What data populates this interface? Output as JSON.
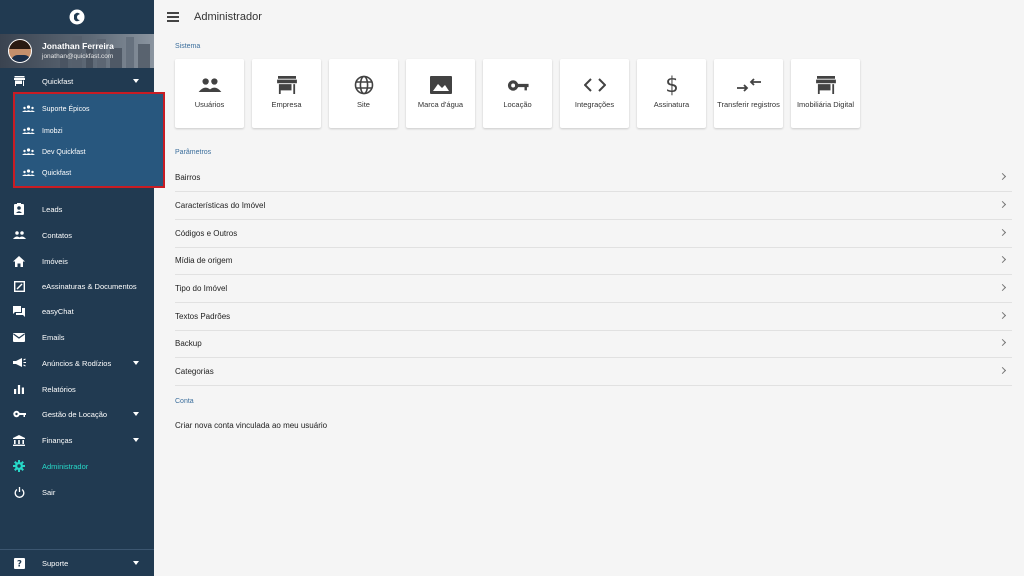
{
  "sidebar": {
    "profile": {
      "name": "Jonathan Ferreira",
      "email": "jonathan@quickfast.com"
    },
    "account": {
      "label": "Quickfast",
      "icon": "store-icon"
    },
    "sub_items": [
      {
        "label": "Suporte Épicos",
        "icon": "groups-icon"
      },
      {
        "label": "Imobzi",
        "icon": "groups-icon"
      },
      {
        "label": "Dev Quickfast",
        "icon": "groups-icon"
      },
      {
        "label": "Quickfast",
        "icon": "groups-icon"
      }
    ],
    "nav": [
      {
        "label": "Leads",
        "icon": "contact-card-icon"
      },
      {
        "label": "Contatos",
        "icon": "people-icon"
      },
      {
        "label": "Imóveis",
        "icon": "home-icon"
      },
      {
        "label": "eAssinaturas & Documentos",
        "icon": "edit-square-icon"
      },
      {
        "label": "easyChat",
        "icon": "chat-icon"
      },
      {
        "label": "Emails",
        "icon": "mail-icon"
      },
      {
        "label": "Anúncios & Rodízios",
        "icon": "megaphone-icon"
      },
      {
        "label": "Relatórios",
        "icon": "bar-chart-icon"
      },
      {
        "label": "Gestão de Locação",
        "icon": "key-icon"
      },
      {
        "label": "Finanças",
        "icon": "bank-icon"
      },
      {
        "label": "Administrador",
        "icon": "gear-icon"
      },
      {
        "label": "Sair",
        "icon": "power-icon"
      }
    ],
    "support": {
      "label": "Suporte",
      "icon": "help-icon"
    },
    "active_color": "#27d8c8"
  },
  "header": {
    "title": "Administrador"
  },
  "sistema": {
    "label": "Sistema",
    "cards": [
      {
        "label": "Usuários",
        "icon": "people-icon"
      },
      {
        "label": "Empresa",
        "icon": "store-icon"
      },
      {
        "label": "Site",
        "icon": "globe-icon"
      },
      {
        "label": "Marca d'água",
        "icon": "image-icon"
      },
      {
        "label": "Locação",
        "icon": "key-icon"
      },
      {
        "label": "Integrações",
        "icon": "code-icon"
      },
      {
        "label": "Assinatura",
        "icon": "dollar-icon"
      },
      {
        "label": "Transferir registros",
        "icon": "swap-arrows-icon"
      },
      {
        "label": "Imobiliária Digital",
        "icon": "store-icon"
      }
    ]
  },
  "parametros": {
    "label": "Parâmetros",
    "items": [
      "Bairros",
      "Características do Imóvel",
      "Códigos e Outros",
      "Mídia de origem",
      "Tipo do Imóvel",
      "Textos Padrões",
      "Backup",
      "Categorias"
    ]
  },
  "conta": {
    "label": "Conta",
    "item": "Criar nova conta vinculada ao meu usuário"
  }
}
